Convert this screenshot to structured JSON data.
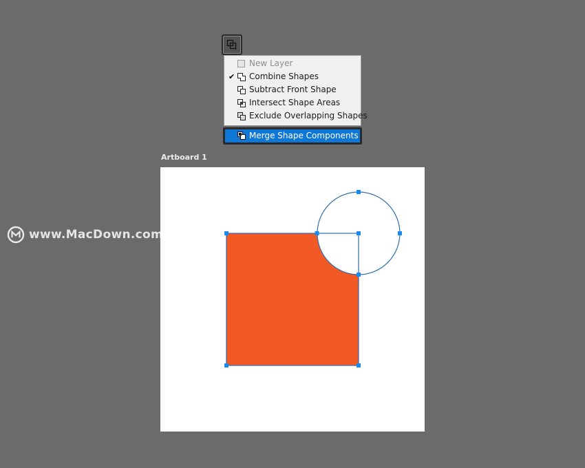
{
  "toolbar": {
    "path_operations_icon": "path-operations-icon"
  },
  "menu": {
    "items": [
      {
        "label": "New Layer",
        "checked": false,
        "enabled": false,
        "icon": "new-layer-icon"
      },
      {
        "label": "Combine Shapes",
        "checked": true,
        "enabled": true,
        "icon": "combine-shapes-icon"
      },
      {
        "label": "Subtract Front Shape",
        "checked": false,
        "enabled": true,
        "icon": "subtract-front-shape-icon"
      },
      {
        "label": "Intersect Shape Areas",
        "checked": false,
        "enabled": true,
        "icon": "intersect-shape-areas-icon"
      },
      {
        "label": "Exclude Overlapping Shapes",
        "checked": false,
        "enabled": true,
        "icon": "exclude-overlapping-shapes-icon"
      }
    ],
    "check_glyph": "✔",
    "highlighted": {
      "label": "Merge Shape Components",
      "icon": "merge-shape-components-icon"
    },
    "highlight_color": "#0f78d7"
  },
  "artboard": {
    "label": "Artboard 1",
    "shape_fill": "#f15a24",
    "path_color": "#2b6cb0",
    "handle_color": "#1e88e5"
  },
  "watermark": {
    "text": "www.MacDown.com",
    "icon": "macdown-logo-icon"
  }
}
